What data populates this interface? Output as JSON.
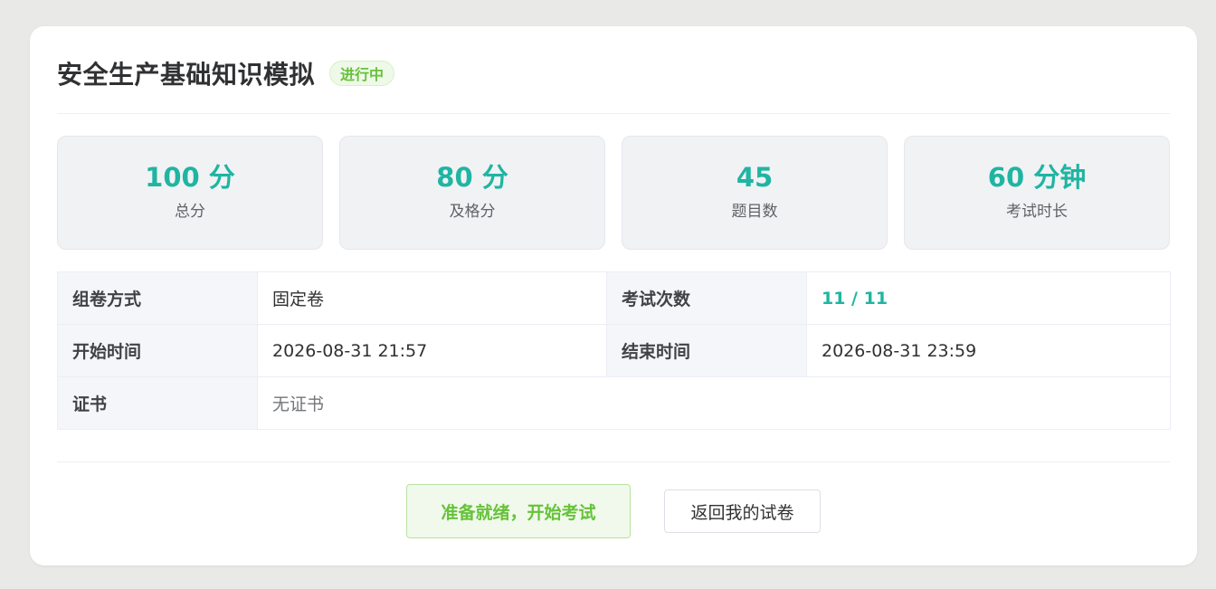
{
  "exam": {
    "title": "安全生产基础知识模拟",
    "status": "进行中"
  },
  "stats": [
    {
      "value": "100 分",
      "label": "总分"
    },
    {
      "value": "80 分",
      "label": "及格分"
    },
    {
      "value": "45",
      "label": "题目数"
    },
    {
      "value": "60 分钟",
      "label": "考试时长"
    }
  ],
  "details": {
    "mode_label": "组卷方式",
    "mode_value": "固定卷",
    "attempts_label": "考试次数",
    "attempts_value": "11 / 11",
    "start_label": "开始时间",
    "start_value": "2026-08-31 21:57",
    "end_label": "结束时间",
    "end_value": "2026-08-31 23:59",
    "cert_label": "证书",
    "cert_value": "无证书"
  },
  "actions": {
    "start_label": "准备就绪，开始考试",
    "back_label": "返回我的试卷"
  },
  "colors": {
    "accent": "#1fb5a2",
    "success": "#67c23a",
    "background": "#e9e9e7"
  }
}
